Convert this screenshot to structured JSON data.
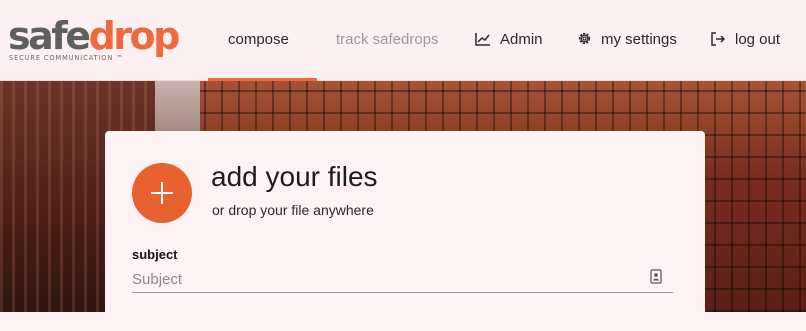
{
  "brand": {
    "logo_part1": "safe",
    "logo_part2": "drop",
    "tagline": "SECURE COMMUNICATION ™",
    "accent_color": "#ee6a3b",
    "gray_color": "#5f5f5f"
  },
  "nav": {
    "compose": "compose",
    "track": "track safedrops",
    "admin": "Admin",
    "settings": "my settings",
    "logout": "log out",
    "active": "compose"
  },
  "icons": {
    "admin": "chart-line-icon",
    "settings": "gear-icon",
    "logout": "logout-icon",
    "add": "plus-icon",
    "field": "contact-card-icon"
  },
  "compose": {
    "title": "add your files",
    "subtitle": "or drop your file anywhere",
    "subject_label": "subject",
    "subject_placeholder": "Subject",
    "subject_value": ""
  }
}
